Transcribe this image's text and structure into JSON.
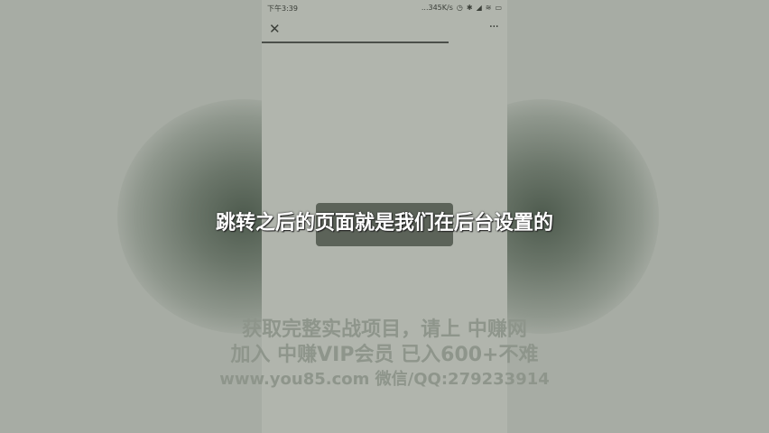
{
  "status_bar": {
    "time": "下午3:39",
    "speed": "...345K/s",
    "icons": [
      "alarm-icon",
      "bluetooth-icon",
      "signal-icon",
      "signal-icon",
      "wifi-icon",
      "battery-icon"
    ]
  },
  "nav": {
    "close_label": "✕",
    "more_label": "···"
  },
  "page": {
    "load_progress": 0.76
  },
  "subtitle": "跳转之后的页面就是我们在后台设置的",
  "watermark": {
    "line1": "获取完整实战项目，请上 中赚网",
    "line2": "加入 中赚VIP会员 已入600+不难",
    "line3": "www.you85.com 微信/QQ:279233914"
  },
  "colors": {
    "background": "#a7aca4",
    "phone_screen": "#b1b5ad",
    "toast": "#5c6359",
    "subtitle": "#ffffff",
    "watermark": "#8e958b"
  }
}
